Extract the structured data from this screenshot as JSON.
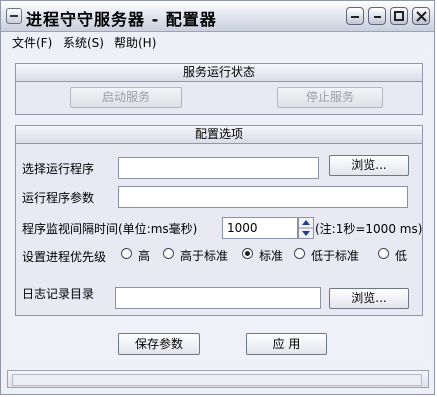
{
  "window": {
    "title": "进程守守服务器 - 配置器",
    "icons": [
      "system-menu-icon",
      "minimize-icon",
      "restore-icon",
      "maximize-icon",
      "close-icon"
    ]
  },
  "menu": {
    "file": "文件(F)",
    "system": "系统(S)",
    "help": "帮助(H)"
  },
  "service_group": {
    "title": "服务运行状态",
    "start_label": "启动服务",
    "stop_label": "停止服务"
  },
  "config_group": {
    "title": "配置选项",
    "program_label": "选择运行程序",
    "program_value": "",
    "browse_label": "浏览...",
    "args_label": "运行程序参数",
    "args_value": "",
    "interval_label": "程序监视间隔时间(单位:ms毫秒)",
    "interval_value": "1000",
    "interval_note": "(注:1秒=1000 ms)",
    "priority_label": "设置进程优先级",
    "priority_options": [
      "高",
      "高于标准",
      "标准",
      "低于标准",
      "低"
    ],
    "priority_selected": "标准",
    "log_label": "日志记录目录",
    "log_value": "",
    "log_browse_label": "浏览..."
  },
  "actions": {
    "save_label": "保存参数",
    "apply_label": "应 用"
  },
  "colors": {
    "window_bg": "#eef0f7",
    "group_border": "#8e97ab",
    "disabled_text": "#9a9ea8"
  }
}
